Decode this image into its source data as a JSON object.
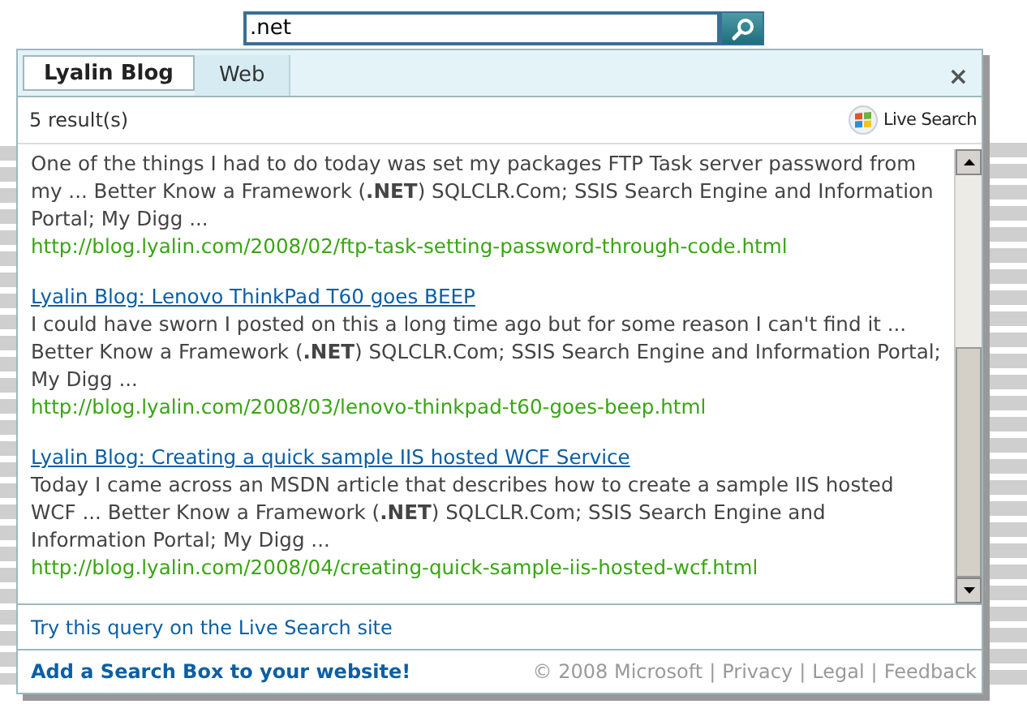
{
  "search": {
    "value": ".net"
  },
  "tabs": [
    {
      "label": "Lyalin Blog",
      "selected": true
    },
    {
      "label": "Web",
      "selected": false
    }
  ],
  "close": "×",
  "result_count": "5 result(s)",
  "brand": "Live Search",
  "results": [
    {
      "snippet": "One of the things I had to do today was set my packages FTP Task server password from my ... Better Know a Framework (**.NET**) SQLCLR.Com; SSIS Search Engine and Information Portal; My Digg ...",
      "url": "http://blog.lyalin.com/2008/02/ftp-task-setting-password-through-code.html"
    },
    {
      "title": "Lyalin Blog: Lenovo ThinkPad T60 goes BEEP",
      "snippet": "I could have sworn I posted on this a long time ago but for some reason I can't find it ... Better Know a Framework (**.NET**) SQLCLR.Com; SSIS Search Engine and Information Portal; My Digg ...",
      "url": "http://blog.lyalin.com/2008/03/lenovo-thinkpad-t60-goes-beep.html"
    },
    {
      "title": "Lyalin Blog: Creating a quick sample IIS hosted WCF Service",
      "snippet": "Today I came across an MSDN article that describes how to create a sample IIS hosted WCF ... Better Know a Framework (**.NET**) SQLCLR.Com; SSIS Search Engine and Information Portal; My Digg ...",
      "url": "http://blog.lyalin.com/2008/04/creating-quick-sample-iis-hosted-wcf.html"
    }
  ],
  "try_link": "Try this query on the Live Search site",
  "add_link": "Add a Search Box to your website!",
  "footer": [
    "© 2008 Microsoft",
    "|",
    "Privacy",
    "|",
    "Legal",
    "|",
    "Feedback"
  ]
}
